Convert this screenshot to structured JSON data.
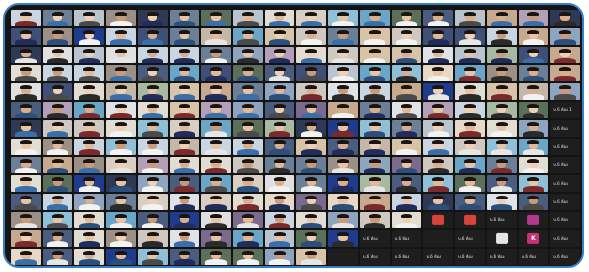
{
  "window": {
    "title": ""
  },
  "gallery": {
    "columns": 18,
    "rows": 14,
    "dark_tiles": [
      {
        "row": 5,
        "col": 17,
        "label": "บ.6 ห้อง 1",
        "sub": ""
      },
      {
        "row": 6,
        "col": 17,
        "label": "บ.6 ห้อง",
        "sub": ""
      },
      {
        "row": 7,
        "col": 17,
        "label": "บ.6 ห้อง",
        "sub": ""
      },
      {
        "row": 8,
        "col": 17,
        "label": "บ.6 ห้อง",
        "sub": ""
      },
      {
        "row": 9,
        "col": 17,
        "label": "บ.6 ห้อง",
        "sub": ""
      },
      {
        "row": 10,
        "col": 17,
        "label": "บ.6 ห้อง",
        "sub": ""
      },
      {
        "row": 11,
        "col": 15,
        "label": "บ.6 ห้อง",
        "sub": ""
      },
      {
        "row": 11,
        "col": 16,
        "label": "บ.6 ห้อง",
        "sub": ""
      },
      {
        "row": 11,
        "col": 17,
        "label": "บ.6 ห้อง",
        "sub": ""
      },
      {
        "row": 12,
        "col": 11,
        "label": "บ.6 ห้อง",
        "sub": ""
      },
      {
        "row": 12,
        "col": 12,
        "label": "บ.6 ห้อง",
        "sub": ""
      },
      {
        "row": 12,
        "col": 13,
        "label": "",
        "sub": ""
      },
      {
        "row": 12,
        "col": 14,
        "label": "บ.6 ห้อง",
        "sub": ""
      },
      {
        "row": 12,
        "col": 15,
        "label": "",
        "sub": ""
      },
      {
        "row": 12,
        "col": 16,
        "label": "",
        "sub": ""
      },
      {
        "row": 12,
        "col": 17,
        "label": "บ.6 ห้อง",
        "sub": ""
      },
      {
        "row": 13,
        "col": 10,
        "label": "",
        "sub": ""
      },
      {
        "row": 13,
        "col": 11,
        "label": "บ.6 ห้อง",
        "sub": ""
      },
      {
        "row": 13,
        "col": 12,
        "label": "บ.6 ห้อง",
        "sub": ""
      },
      {
        "row": 13,
        "col": 13,
        "label": "บ.6 ห้อง",
        "sub": ""
      },
      {
        "row": 13,
        "col": 14,
        "label": "บ.6 ห้อง",
        "sub": ""
      },
      {
        "row": 13,
        "col": 15,
        "label": "บ.6 ห้อง",
        "sub": ""
      },
      {
        "row": 13,
        "col": 16,
        "label": "บ.6 ห้อง",
        "sub": ""
      },
      {
        "row": 13,
        "col": 17,
        "label": "บ.6 ห้อง",
        "sub": ""
      }
    ],
    "avatar_tiles": [
      {
        "row": 11,
        "col": 13,
        "letter": "",
        "color": "#d6453d"
      },
      {
        "row": 11,
        "col": 14,
        "letter": "",
        "color": "#d6453d"
      },
      {
        "row": 11,
        "col": 16,
        "letter": "",
        "color": "#b03a8c"
      },
      {
        "row": 12,
        "col": 16,
        "letter": "K",
        "color": "#c8327a"
      },
      {
        "row": 12,
        "col": 15,
        "letter": "",
        "color": "#e6e6e6"
      }
    ]
  }
}
